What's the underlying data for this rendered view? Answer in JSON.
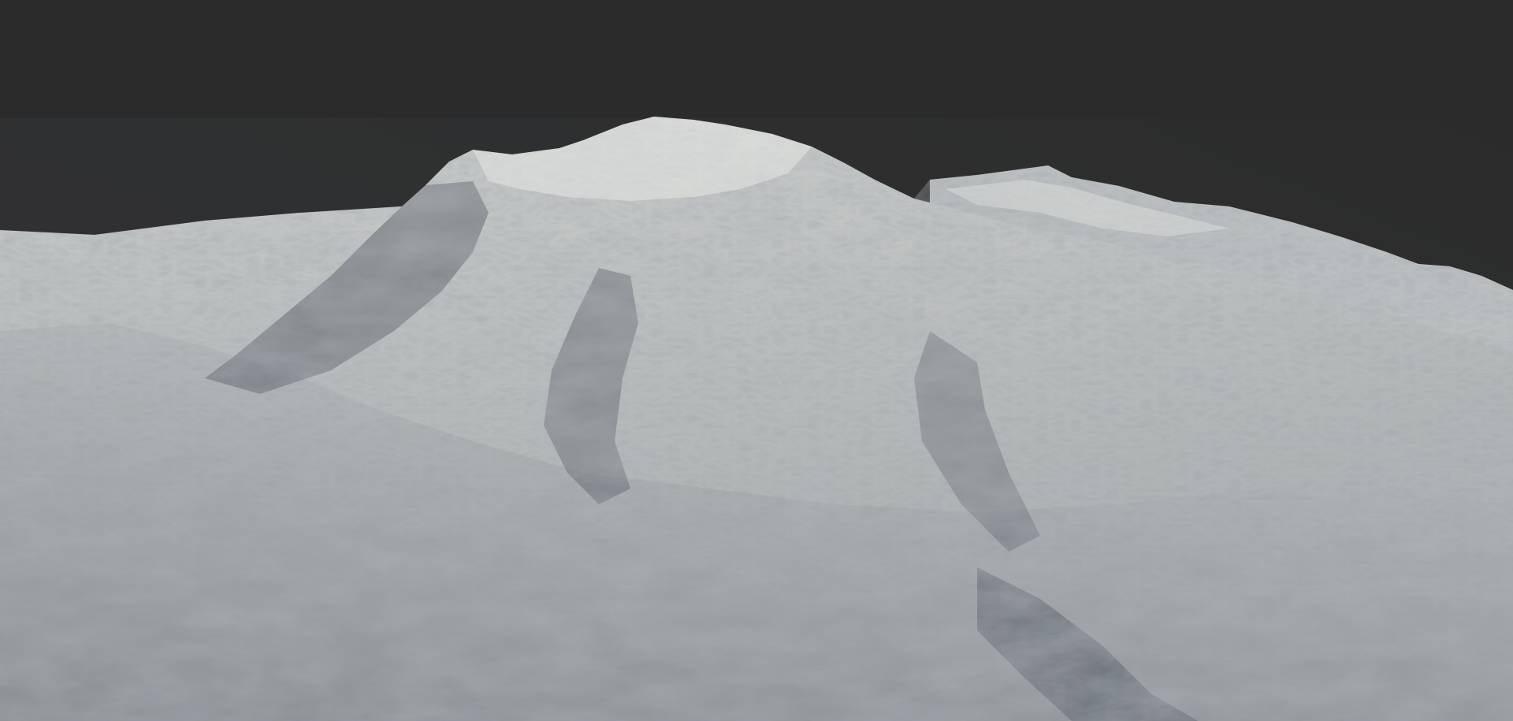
{
  "viewport": {
    "background_color": "#2b2b2b",
    "subject": "terrain-render"
  },
  "terrain": {
    "base_color": "#a9adae",
    "highlight_color": "#d9dcd9",
    "shadow_color": "#4a5058",
    "deep_shadow_color": "#2f353d"
  }
}
